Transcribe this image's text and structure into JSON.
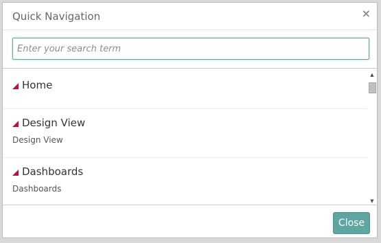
{
  "dialog": {
    "title": "Quick Navigation",
    "close_glyph": "×"
  },
  "search": {
    "placeholder": "Enter your search term",
    "value": ""
  },
  "items": [
    {
      "title": "Home",
      "subtitle": ""
    },
    {
      "title": "Design View",
      "subtitle": "Design View"
    },
    {
      "title": "Dashboards",
      "subtitle": "Dashboards"
    }
  ],
  "scrollbar": {
    "up_glyph": "▲",
    "down_glyph": "▼"
  },
  "footer": {
    "close_label": "Close"
  },
  "colors": {
    "accent": "#5fa5a0",
    "marker": "#b5123e"
  }
}
